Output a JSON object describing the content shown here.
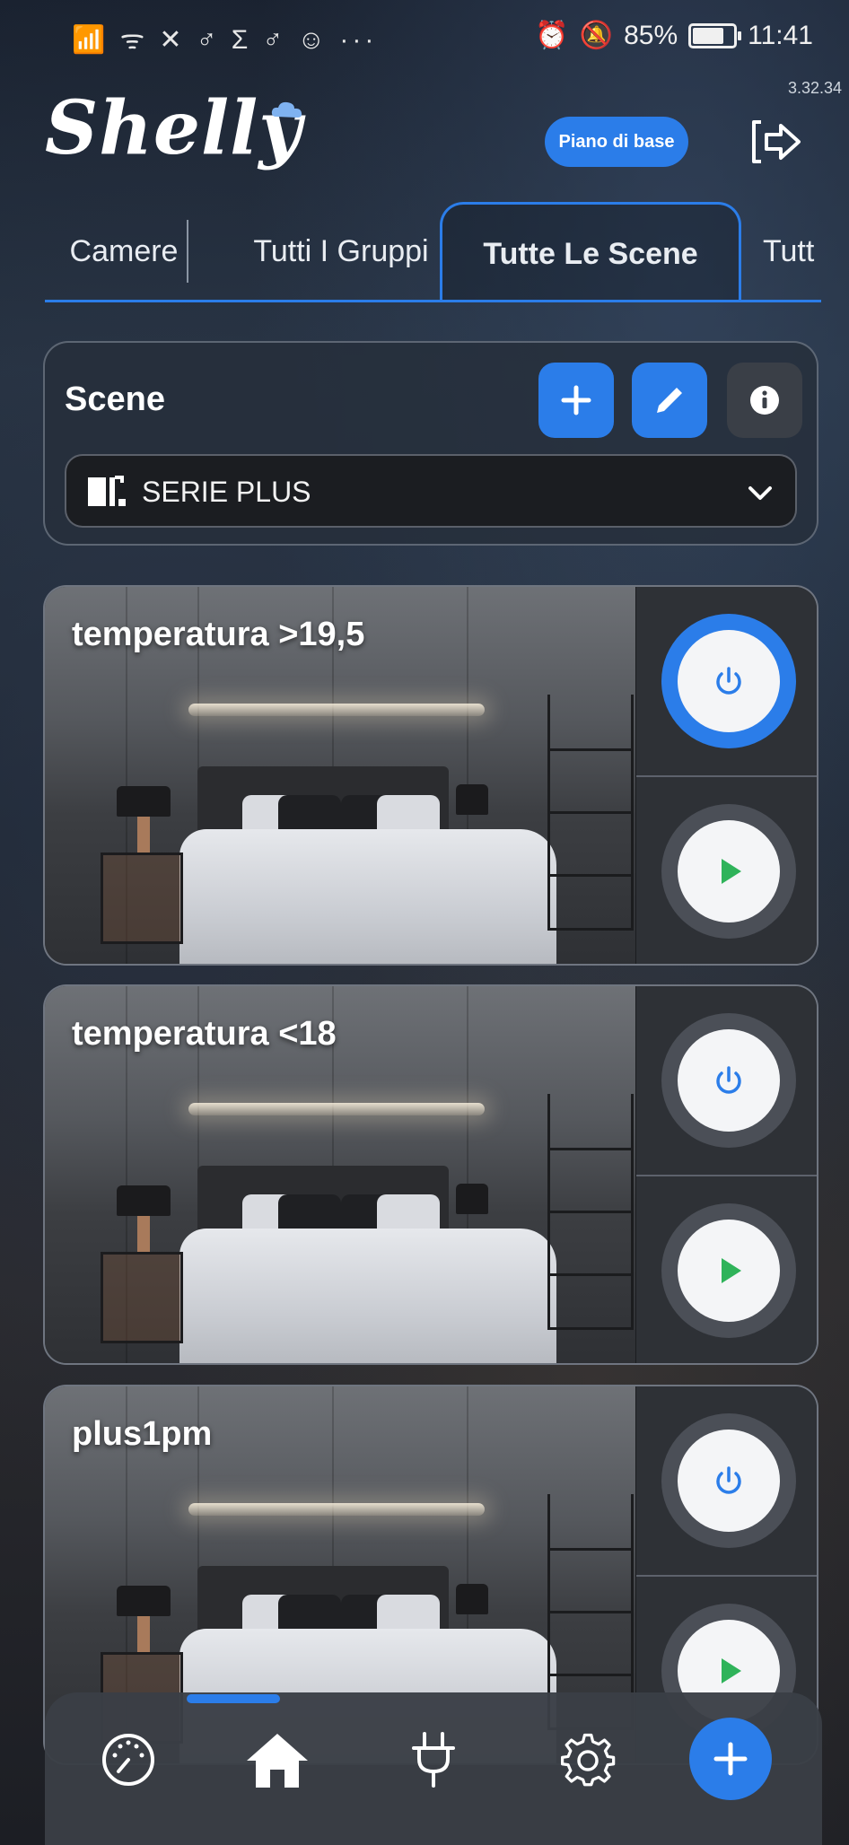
{
  "status_bar": {
    "left_icons": "📶 ᯤ ✕ ♂ Σ ♂ ☺ ···",
    "alarm": "⏰",
    "mute": "🔕",
    "battery_text": "85%",
    "battery_level": 0.85,
    "time": "11:41"
  },
  "header": {
    "version": "3.32.34",
    "logo_text": "Shelly",
    "plan_button": "Piano di base",
    "logout_icon": "logout-icon"
  },
  "tabs": [
    {
      "label": "Camere"
    },
    {
      "label": "Tutti I Gruppi"
    },
    {
      "label": "Tutte Le Scene"
    },
    {
      "label": "Tutt"
    }
  ],
  "scene_panel": {
    "title": "Scene",
    "room_select": "SERIE PLUS"
  },
  "scenes": [
    {
      "name": "temperatura >19,5",
      "power_active": true
    },
    {
      "name": "temperatura <18",
      "power_active": false
    },
    {
      "name": "plus1pm",
      "power_active": false
    }
  ],
  "colors": {
    "accent": "#2b7de9",
    "play_green": "#2fb35a"
  },
  "bottom_nav": {
    "items": [
      "dashboard-icon",
      "home-icon",
      "plug-icon",
      "settings-icon",
      "add-icon"
    ],
    "active": "home-icon"
  }
}
